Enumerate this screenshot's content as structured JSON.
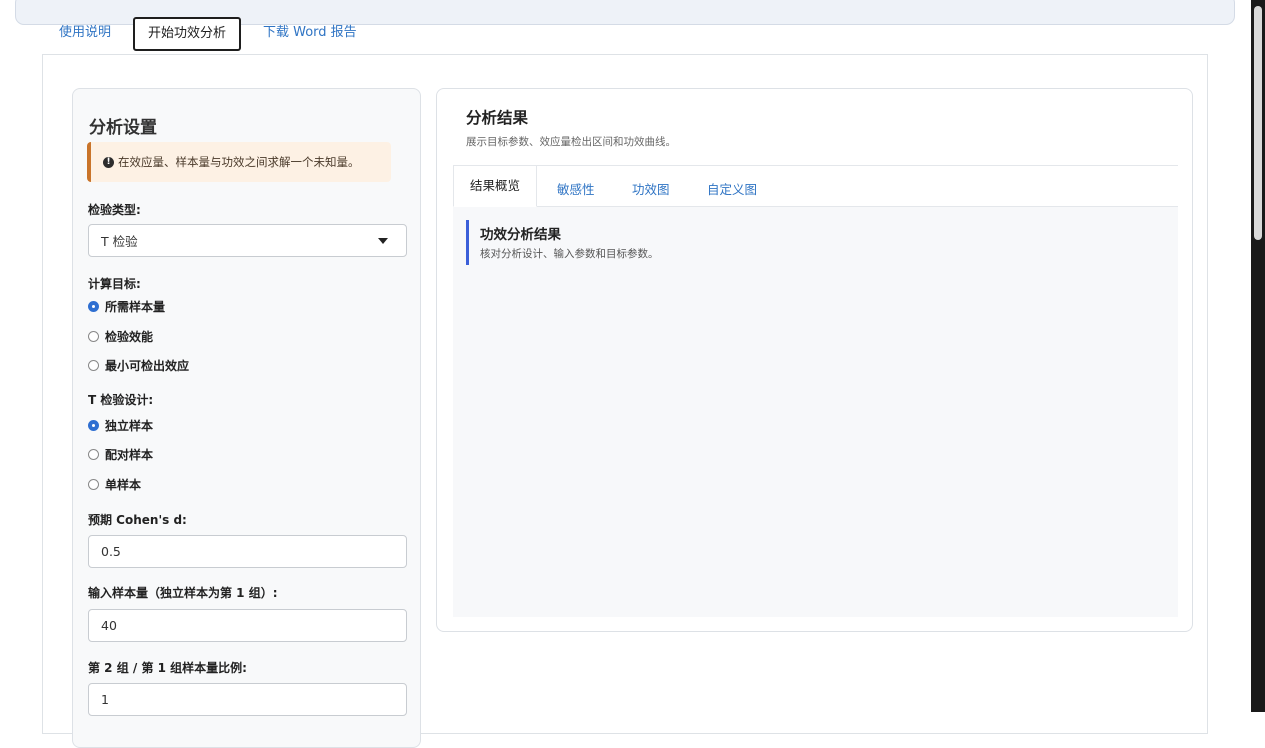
{
  "nav": {
    "tabs": [
      "使用说明",
      "开始功效分析",
      "下载 Word 报告"
    ],
    "active": 1
  },
  "sidebar": {
    "title": "分析设置",
    "note": "在效应量、样本量与功效之间求解一个未知量。",
    "test_type_label": "检验类型:",
    "test_type_value": "T 检验",
    "target_label": "计算目标:",
    "target_options": [
      "所需样本量",
      "检验效能",
      "最小可检出效应"
    ],
    "target_selected": 0,
    "design_label": "T 检验设计:",
    "design_options": [
      "独立样本",
      "配对样本",
      "单样本"
    ],
    "design_selected": 0,
    "cohen_label": "预期 Cohen's d:",
    "cohen_value": "0.5",
    "n_label": "输入样本量（独立样本为第 1 组）:",
    "n_value": "40",
    "ratio_label": "第 2 组 / 第 1 组样本量比例:",
    "ratio_value": "1"
  },
  "main": {
    "title": "分析结果",
    "subtitle": "展示目标参数、效应量检出区间和功效曲线。",
    "tabs": [
      "结果概览",
      "敏感性",
      "功效图",
      "自定义图"
    ],
    "active_tab": 0,
    "result_title": "功效分析结果",
    "result_sub": "核对分析设计、输入参数和目标参数。"
  },
  "colors": {
    "accent": "#2f74c4",
    "radio": "#2f6fd1",
    "note_border": "#c9742a",
    "result_bar": "#3b5fd9"
  }
}
